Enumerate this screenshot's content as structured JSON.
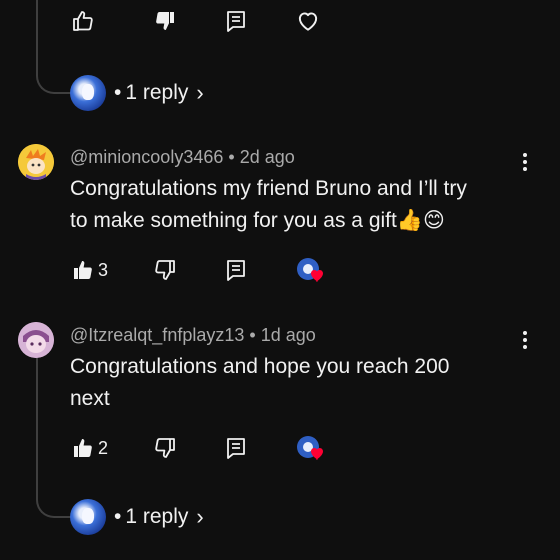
{
  "top_actions": {
    "like_count": ""
  },
  "reply_thread_1": {
    "dot": "•",
    "reply_label": "1 reply"
  },
  "comments": [
    {
      "author": "@minioncooly3466",
      "time": "2d ago",
      "text_line1": "Congratulations my friend Bruno and I’ll try",
      "text_line2": "to make something for you as a gift",
      "emoji": "👍😊",
      "like_count": "3"
    },
    {
      "author": "@Itzrealqt_fnfplayz13",
      "time": "1d ago",
      "text_line1": "Congratulations and hope you reach 200",
      "text_line2": "next",
      "like_count": "2"
    }
  ],
  "reply_thread_2": {
    "dot": "•",
    "reply_label": "1 reply"
  },
  "colors": {
    "background": "#0f0f0f",
    "text": "#f1f1f1",
    "meta": "#aaaaaa",
    "heart": "#ff0033",
    "thread_line": "#3f3f3f"
  },
  "icons": [
    "thumb-up-outline-icon",
    "thumb-down-filled-icon",
    "reply-icon",
    "heart-outline-icon",
    "thumb-up-filled-icon",
    "thumb-down-outline-icon",
    "more-vert-icon",
    "chevron-right-icon",
    "creator-heart-icon"
  ]
}
